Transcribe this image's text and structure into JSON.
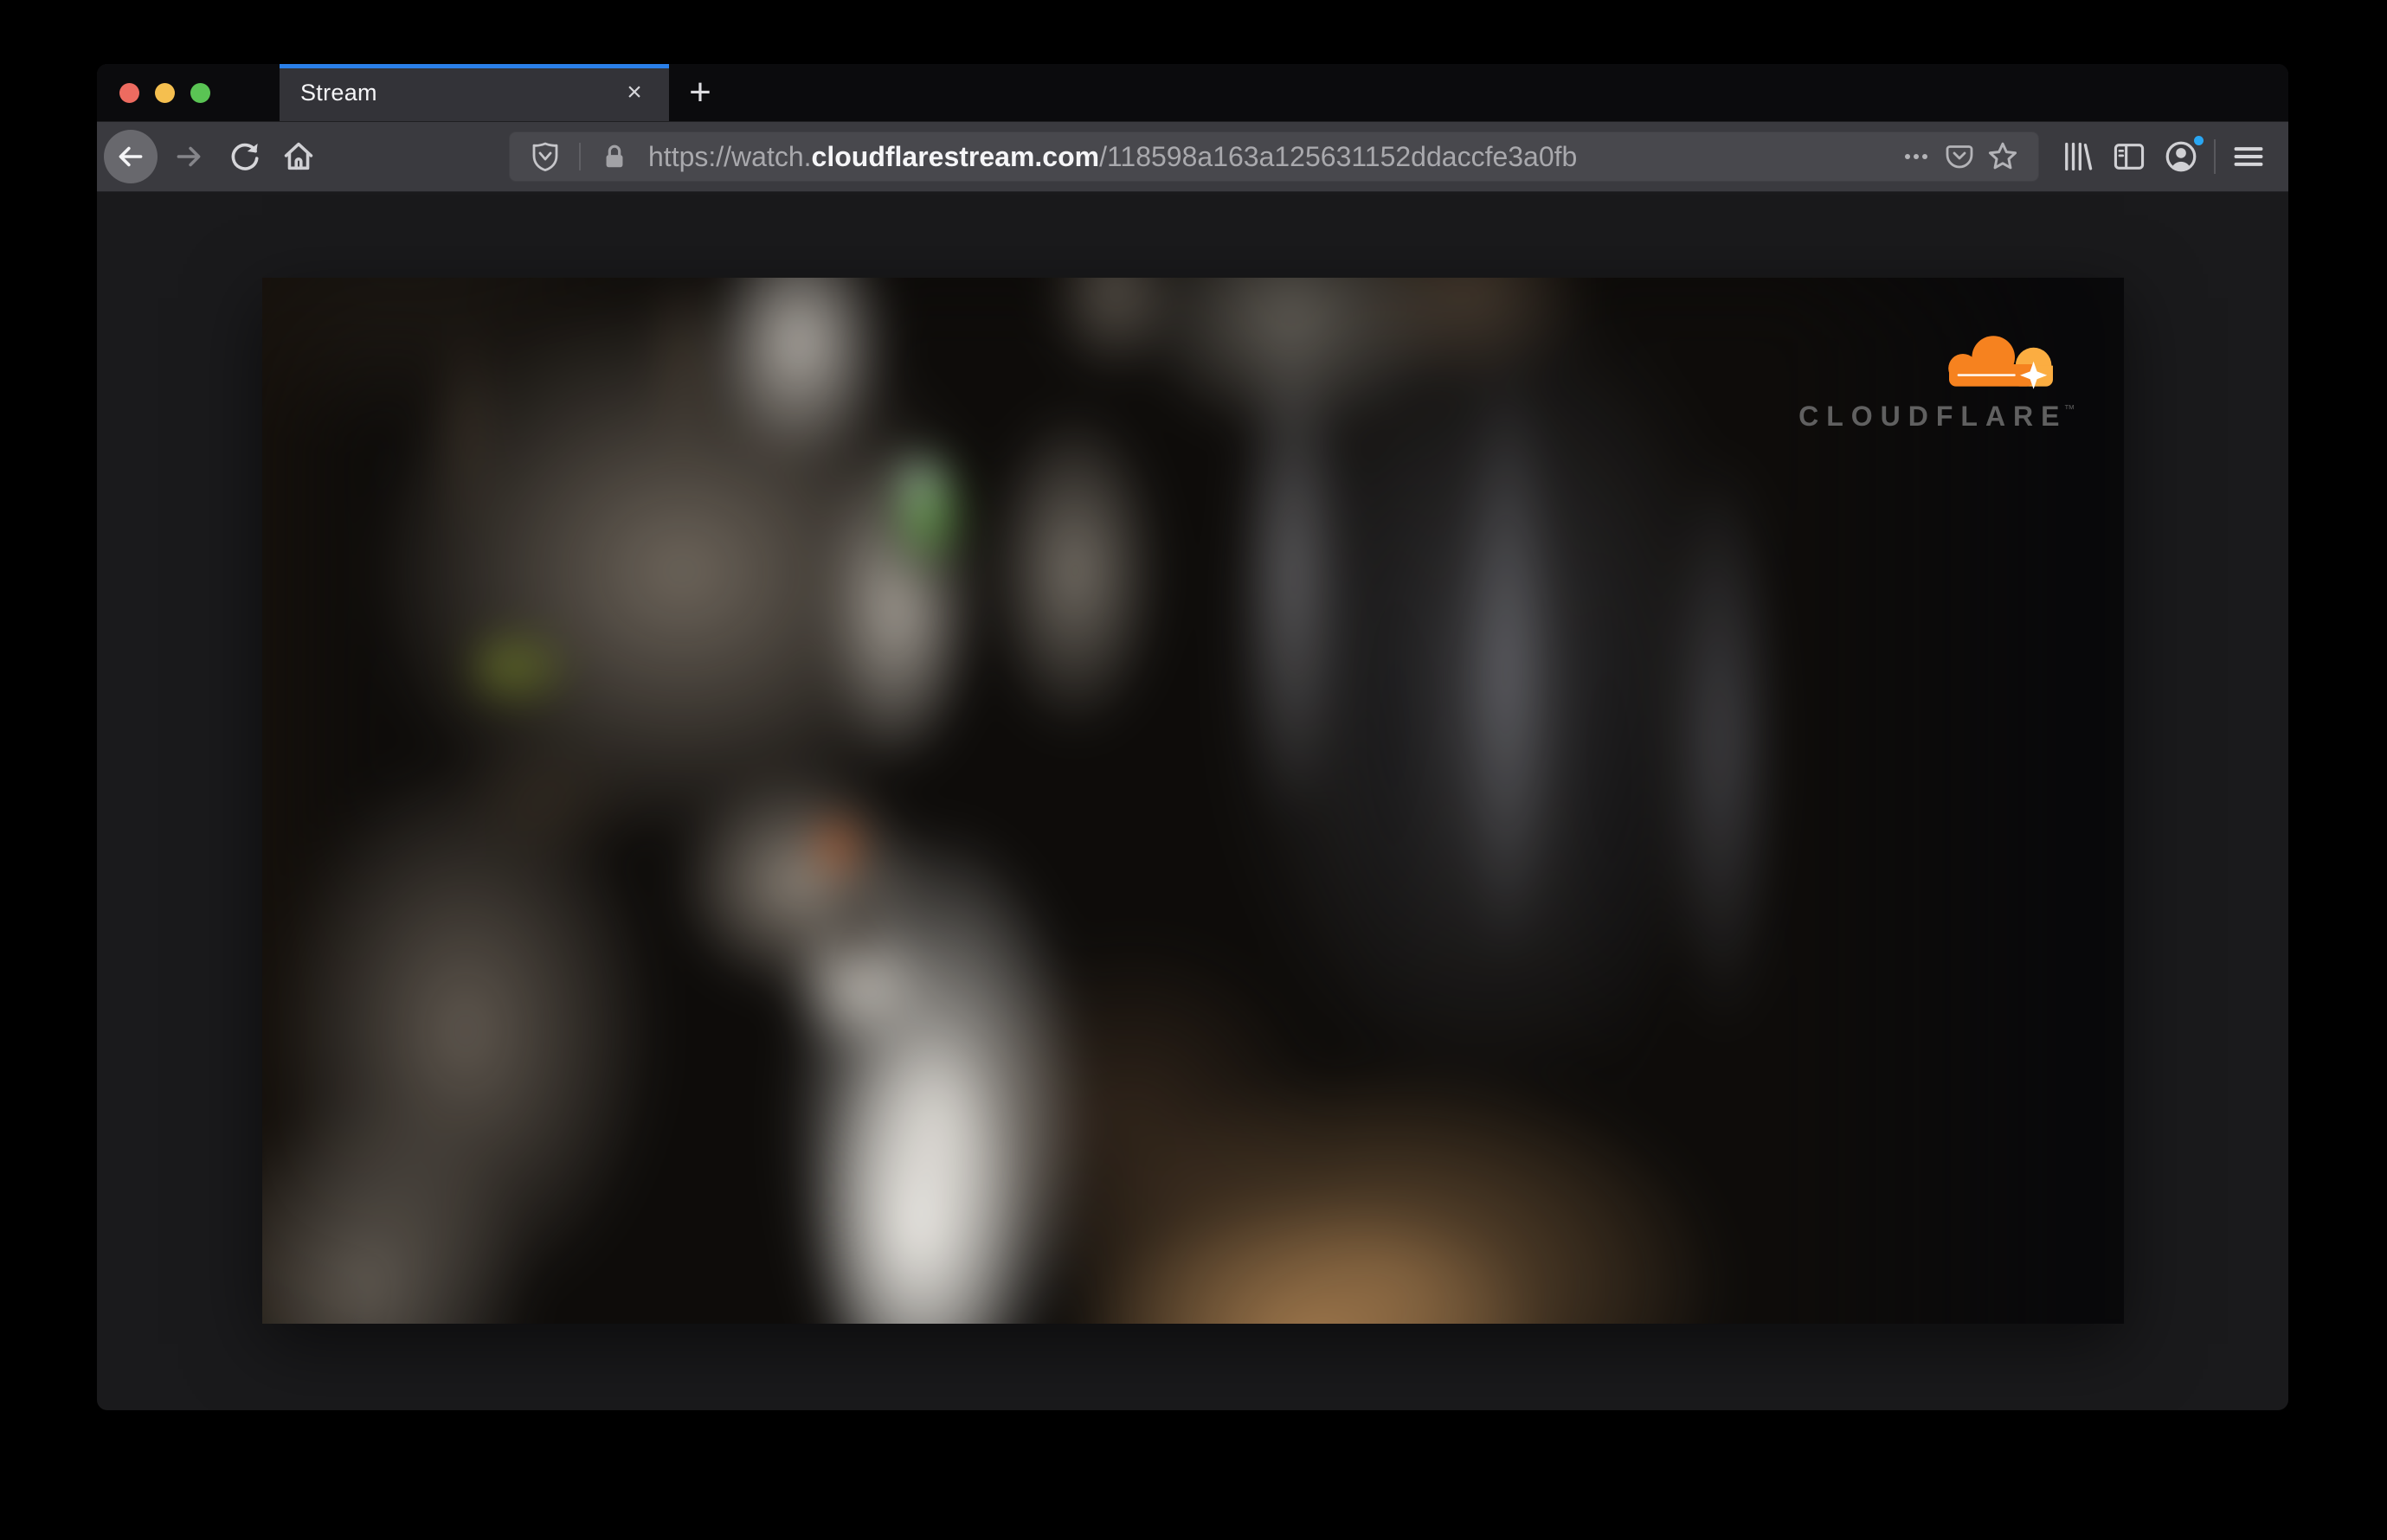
{
  "browser": {
    "tab": {
      "title": "Stream",
      "close_glyph": "×",
      "accent_color": "#2a7fe8"
    },
    "new_tab_glyph": "+",
    "traffic_lights": {
      "red": "#ed6b60",
      "yellow": "#f5bf4f",
      "green": "#5ac454"
    },
    "toolbar_icons": [
      "back-icon",
      "forward-icon",
      "reload-icon",
      "home-icon",
      "library-icon",
      "sidebar-icon",
      "account-icon",
      "menu-icon"
    ],
    "urlbar": {
      "prefix": "https://watch.",
      "domain": "cloudflarestream.com",
      "path": "/118598a163a125631152ddaccfe3a0fb",
      "left_icons": [
        "tracking-protection-shield-icon",
        "lock-icon"
      ],
      "right_icons": [
        "page-actions-dots-icon",
        "pocket-icon",
        "bookmark-star-icon"
      ]
    },
    "account_notification_color": "#29a6f2"
  },
  "video": {
    "description": "blurred close-up of a gray tabby cat with green eyes, white chest, warm brown foreground",
    "logo": {
      "brand": "CLOUDFLARE",
      "trademark": "™",
      "cloud_color": "#f6821f",
      "cloud_light_color": "#fbad41",
      "text_color": "#606060"
    }
  }
}
